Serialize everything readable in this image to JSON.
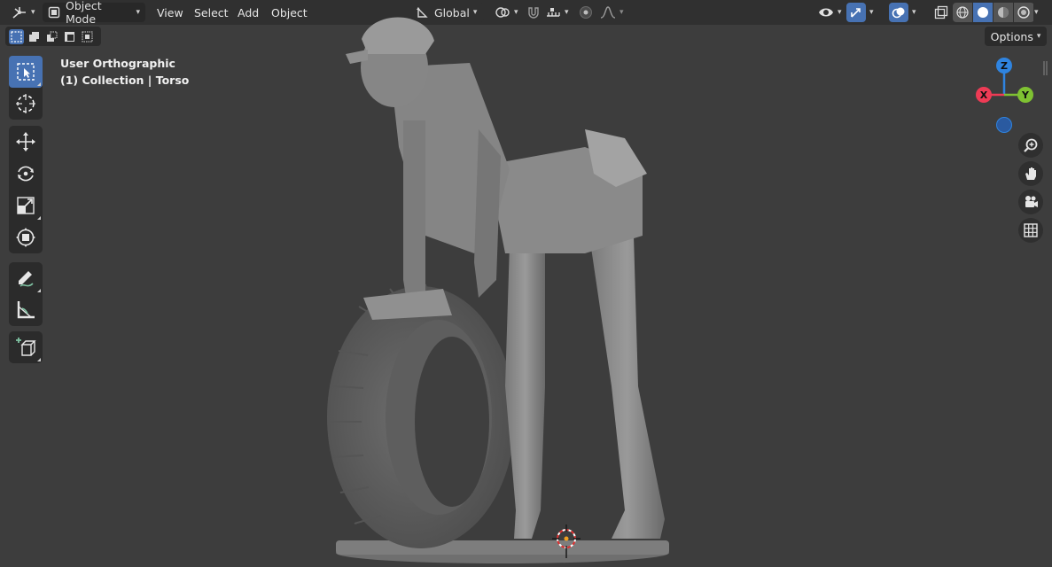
{
  "header": {
    "mode_label": "Object Mode",
    "menus": [
      "View",
      "Select",
      "Add",
      "Object"
    ],
    "transform_orientation": "Global",
    "options_label": "Options"
  },
  "viewport": {
    "view_name": "User Orthographic",
    "context": "(1) Collection | Torso"
  },
  "gizmo": {
    "axes": {
      "z": "Z",
      "x": "X",
      "y": "Y"
    },
    "colors": {
      "x": "#ee3b55",
      "y": "#7fc232",
      "z": "#2f84e0",
      "neg": "#2a6cc4"
    }
  },
  "icons": {
    "editor_type": "editor-type-icon",
    "select_box": "select-box-icon",
    "cursor": "cursor-icon",
    "move": "move-icon",
    "rotate": "rotate-icon",
    "scale": "scale-icon",
    "transform": "transform-icon",
    "annotate": "annotate-icon",
    "measure": "measure-icon",
    "add_cube": "add-cube-icon",
    "zoom": "zoom-icon",
    "pan": "hand-icon",
    "camera": "camera-icon",
    "grid": "grid-icon"
  },
  "colors": {
    "accent": "#4772b3",
    "background": "#3d3d3d",
    "header": "#303030"
  }
}
